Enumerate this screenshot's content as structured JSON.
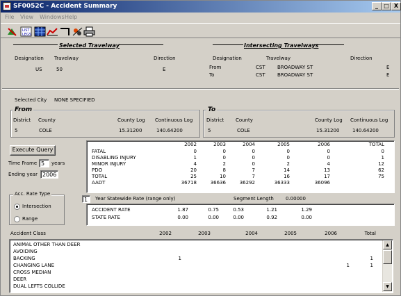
{
  "window": {
    "title": "SF0052C - Accident Summary",
    "minimize": "_",
    "maximize": "□",
    "close": "X"
  },
  "menu": [
    "File",
    "View",
    "Windows",
    "Help"
  ],
  "toolbar": [
    "run-icon",
    "list-legs-icon",
    "grid-icon",
    "chart-icon",
    "exit-icon",
    "tools-icon",
    "print-icon"
  ],
  "toolbar_text": {
    "list_legs_line1": "LIST",
    "list_legs_line2": "LEGS"
  },
  "selected_travelway": {
    "title": "Selected Travelway",
    "designation_label": "Designation",
    "travelway_label": "Travelway",
    "direction_label": "Direction",
    "designation": "US",
    "travelway": "50",
    "direction": "E"
  },
  "intersecting_travelways": {
    "title": "Intersecting Travelways",
    "designation_label": "Designation",
    "travelway_label": "Travelway",
    "direction_label": "Direction",
    "rows": [
      {
        "label": "From",
        "designation": "CST",
        "travelway": "BROADWAY ST",
        "direction": "E"
      },
      {
        "label": "To",
        "designation": "CST",
        "travelway": "BROADWAY ST",
        "direction": "E"
      }
    ]
  },
  "selected_city": {
    "label": "Selected City",
    "value": "NONE SPECIFIED"
  },
  "from": {
    "title": "From",
    "district_label": "District",
    "county_label": "County",
    "county_log_label": "County Log",
    "continuous_log_label": "Continuous Log",
    "district": "5",
    "county": "COLE",
    "county_log": "15.31200",
    "continuous_log": "140.64200"
  },
  "to": {
    "title": "To",
    "district_label": "District",
    "county_label": "County",
    "county_log_label": "County Log",
    "continuous_log_label": "Continuous Log",
    "district": "5",
    "county": "COLE",
    "county_log": "15.31200",
    "continuous_log": "140.64200"
  },
  "query": {
    "execute_label": "Execute Query",
    "time_frame_label": "Time Frame",
    "time_frame": "5",
    "years_label": "years",
    "ending_year_label": "Ending year",
    "ending_year": "2006"
  },
  "rate_type": {
    "title": "Acc. Rate Type",
    "options": [
      "Intersection",
      "Range"
    ],
    "selected": "Intersection"
  },
  "summary": {
    "years": [
      "2002",
      "2003",
      "2004",
      "2005",
      "2006"
    ],
    "total_label": "TOTAL",
    "rows": [
      {
        "label": "FATAL",
        "values": [
          "0",
          "0",
          "0",
          "0",
          "0"
        ],
        "total": "0"
      },
      {
        "label": "DISABLING INJURY",
        "values": [
          "1",
          "0",
          "0",
          "0",
          "0"
        ],
        "total": "1"
      },
      {
        "label": "MINOR INJURY",
        "values": [
          "4",
          "2",
          "0",
          "2",
          "4"
        ],
        "total": "12"
      },
      {
        "label": "PDO",
        "values": [
          "20",
          "8",
          "7",
          "14",
          "13"
        ],
        "total": "62"
      },
      {
        "label": "TOTAL",
        "values": [
          "25",
          "10",
          "7",
          "16",
          "17"
        ],
        "total": "75"
      },
      {
        "label": "AADT",
        "values": [
          "36718",
          "36636",
          "36292",
          "36333",
          "36096"
        ],
        "total": ""
      }
    ]
  },
  "rate_options": {
    "years": "1",
    "statewide_label": "Year Statewide Rate (range only)",
    "segment_label": "Segment Length",
    "segment_value": "0.00000"
  },
  "rates": [
    {
      "label": "ACCIDENT RATE",
      "values": [
        "1.87",
        "0.75",
        "0.53",
        "1.21",
        "1.29"
      ]
    },
    {
      "label": "STATE RATE",
      "values": [
        "0.00",
        "0.00",
        "0.00",
        "0.92",
        "0.00"
      ]
    }
  ],
  "accident_class": {
    "label": "Accident Class",
    "years": [
      "2002",
      "2003",
      "2004",
      "2005",
      "2006"
    ],
    "total_label": "Total",
    "rows": [
      {
        "name": "ANIMAL OTHER THAN DEER",
        "values": [
          "",
          "",
          "",
          "",
          ""
        ],
        "total": ""
      },
      {
        "name": "AVOIDING",
        "values": [
          "",
          "",
          "",
          "",
          ""
        ],
        "total": ""
      },
      {
        "name": "BACKING",
        "values": [
          "1",
          "",
          "",
          "",
          ""
        ],
        "total": "1"
      },
      {
        "name": "CHANGING LANE",
        "values": [
          "",
          "",
          "",
          "",
          "1"
        ],
        "total": "1"
      },
      {
        "name": "CROSS MEDIAN",
        "values": [
          "",
          "",
          "",
          "",
          ""
        ],
        "total": ""
      },
      {
        "name": "DEER",
        "values": [
          "",
          "",
          "",
          "",
          ""
        ],
        "total": ""
      },
      {
        "name": "DUAL LEFTS COLLIDE",
        "values": [
          "",
          "",
          "",
          "",
          ""
        ],
        "total": ""
      }
    ]
  }
}
